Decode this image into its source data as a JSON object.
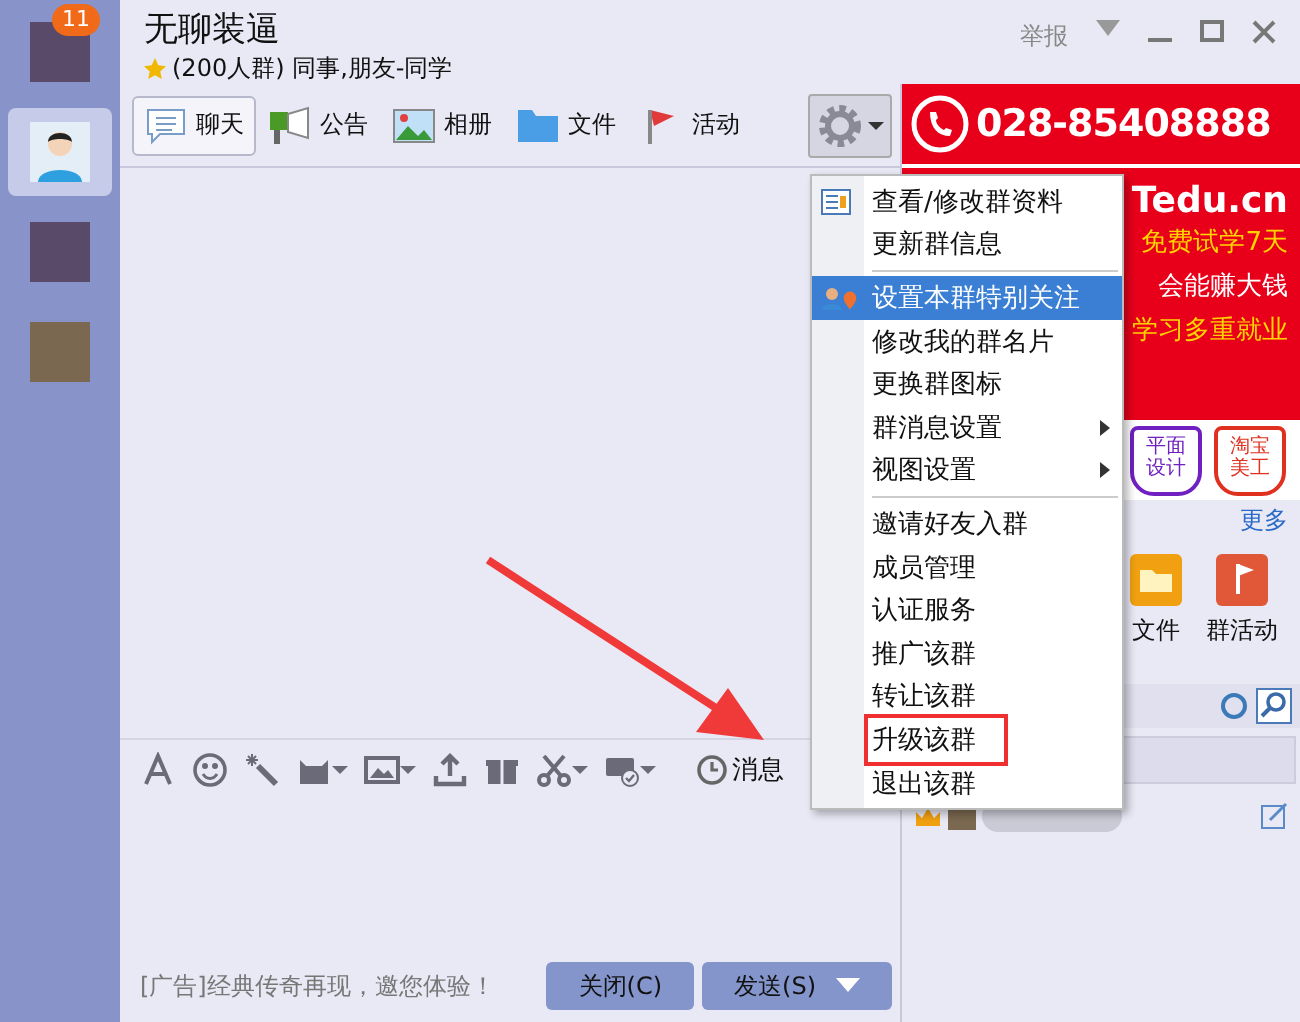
{
  "sidebar": {
    "chats": [
      {
        "badge": "11",
        "selected": false
      },
      {
        "selected": true
      },
      {
        "selected": false
      },
      {
        "selected": false
      }
    ]
  },
  "header": {
    "title": "无聊装逼",
    "subtitle": "(200人群) 同事,朋友-同学",
    "report": "举报"
  },
  "tabs": [
    {
      "label": "聊天",
      "selected": true
    },
    {
      "label": "公告",
      "selected": false
    },
    {
      "label": "相册",
      "selected": false
    },
    {
      "label": "文件",
      "selected": false
    },
    {
      "label": "活动",
      "selected": false
    }
  ],
  "toolbar": {
    "history": "消息"
  },
  "footer": {
    "ad": "[广告]经典传奇再现，邀您体验！",
    "close": "关闭(C)",
    "send": "发送(S)"
  },
  "ad": {
    "phone": "028-85408888",
    "logo": "Tedu.cn",
    "lines": [
      "免费试学7天",
      "会能赚大钱",
      "学习多重就业"
    ],
    "badges": [
      "平面设计",
      "淘宝美工"
    ]
  },
  "apps": {
    "more": "更多",
    "items": [
      "文件",
      "群活动"
    ]
  },
  "menu": [
    {
      "kind": "info",
      "label": "查看/修改群资料",
      "selected": false
    },
    {
      "kind": "item",
      "label": "更新群信息",
      "selected": false
    },
    {
      "kind": "separator"
    },
    {
      "kind": "follow",
      "label": "设置本群特别关注",
      "selected": true
    },
    {
      "kind": "item",
      "label": "修改我的群名片",
      "selected": false
    },
    {
      "kind": "item",
      "label": "更换群图标",
      "selected": false
    },
    {
      "kind": "submenu",
      "label": "群消息设置",
      "selected": false
    },
    {
      "kind": "submenu",
      "label": "视图设置",
      "selected": false
    },
    {
      "kind": "separator"
    },
    {
      "kind": "item",
      "label": "邀请好友入群",
      "selected": false
    },
    {
      "kind": "item",
      "label": "成员管理",
      "selected": false
    },
    {
      "kind": "item",
      "label": "认证服务",
      "selected": false
    },
    {
      "kind": "item",
      "label": "推广该群",
      "selected": false
    },
    {
      "kind": "item",
      "label": "转让该群",
      "selected": false
    },
    {
      "kind": "item",
      "label": "升级该群",
      "selected": false,
      "highlighted": true
    },
    {
      "kind": "item",
      "label": "退出该群",
      "selected": false
    }
  ]
}
